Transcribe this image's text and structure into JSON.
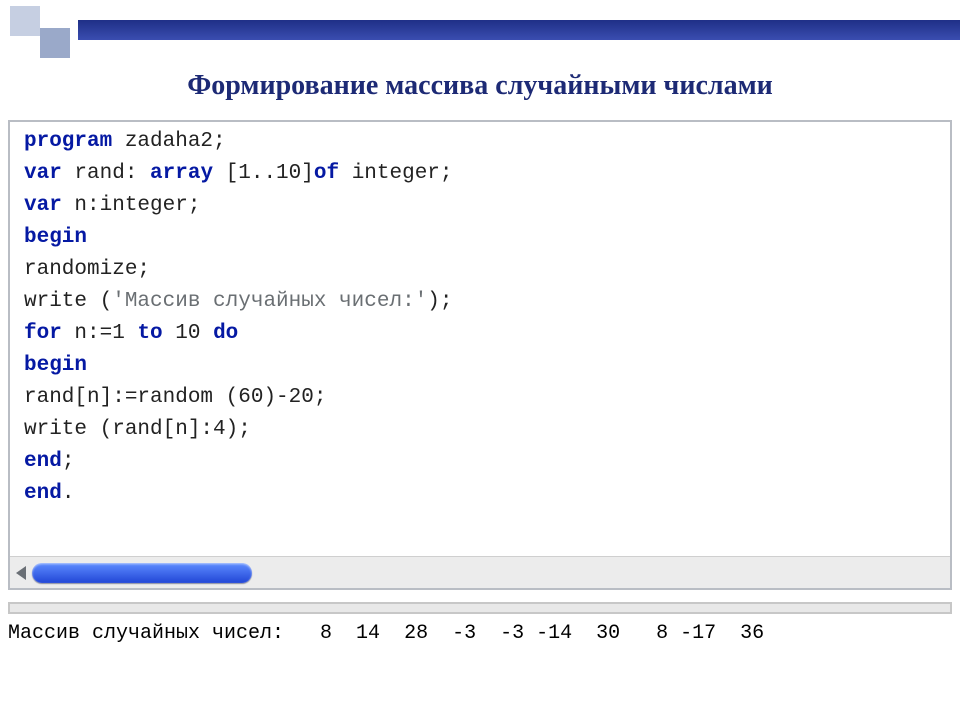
{
  "title": "Формирование массива случайными числами",
  "code": {
    "line1_kw": "program",
    "line1_rest": " zadaha2;",
    "line2_kw1": "var",
    "line2_mid": " rand: ",
    "line2_kw2": "array",
    "line2_mid2": " [1..10]",
    "line2_kw3": "of",
    "line2_rest": " integer;",
    "line3_kw": "var",
    "line3_rest": " n:integer;",
    "line4_kw": "begin",
    "line5": "randomize;",
    "line6_a": "write (",
    "line6_str": "'Массив случайных чисел:'",
    "line6_b": ");",
    "line7_kw1": "for",
    "line7_mid1": " n:=1 ",
    "line7_kw2": "to",
    "line7_mid2": " 10 ",
    "line7_kw3": "do",
    "line8_kw": "begin",
    "line9": "rand[n]:=random (60)-20;",
    "line10": "write (rand[n]:4);",
    "line11_kw": "end",
    "line11_semi": ";",
    "line12_kw": "end",
    "line12_dot": "."
  },
  "output": {
    "label": "Массив случайных чисел:",
    "values": [
      8,
      14,
      28,
      -3,
      -3,
      -14,
      30,
      8,
      -17,
      36
    ],
    "rendered": "Массив случайных чисел:   8  14  28  -3  -3 -14  30   8 -17  36"
  }
}
